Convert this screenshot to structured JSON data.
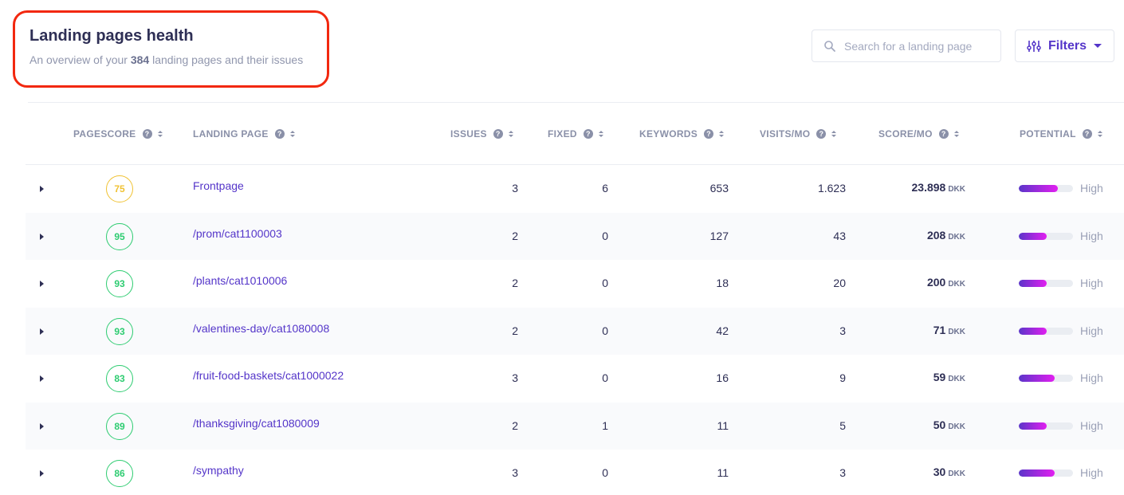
{
  "header": {
    "title": "Landing pages health",
    "subtitle_prefix": "An overview of your ",
    "subtitle_count": "384",
    "subtitle_suffix": " landing pages and their issues"
  },
  "search": {
    "placeholder": "Search for a landing page",
    "value": ""
  },
  "filters": {
    "label": "Filters"
  },
  "colors": {
    "accent": "#5435c9",
    "score_good": "#2ecc71",
    "score_medium": "#f0c233",
    "highlight_box": "#f2280f"
  },
  "columns": [
    {
      "key": "pagescore",
      "label": "PAGESCORE"
    },
    {
      "key": "landing_page",
      "label": "LANDING PAGE"
    },
    {
      "key": "issues",
      "label": "ISSUES"
    },
    {
      "key": "fixed",
      "label": "FIXED"
    },
    {
      "key": "keywords",
      "label": "KEYWORDS"
    },
    {
      "key": "visits",
      "label": "VISITS/MO"
    },
    {
      "key": "score_mo",
      "label": "SCORE/MO"
    },
    {
      "key": "potential",
      "label": "POTENTIAL"
    }
  ],
  "rows": [
    {
      "pagescore": "75",
      "score_level": "medium",
      "landing_page": "Frontpage",
      "issues": "3",
      "fixed": "6",
      "keywords": "653",
      "visits": "1.623",
      "score_mo": "23.898",
      "currency": "DKK",
      "potential": 0.72,
      "potential_label": "High"
    },
    {
      "pagescore": "95",
      "score_level": "good",
      "landing_page": "/prom/cat1100003",
      "issues": "2",
      "fixed": "0",
      "keywords": "127",
      "visits": "43",
      "score_mo": "208",
      "currency": "DKK",
      "potential": 0.52,
      "potential_label": "High"
    },
    {
      "pagescore": "93",
      "score_level": "good",
      "landing_page": "/plants/cat1010006",
      "issues": "2",
      "fixed": "0",
      "keywords": "18",
      "visits": "20",
      "score_mo": "200",
      "currency": "DKK",
      "potential": 0.52,
      "potential_label": "High"
    },
    {
      "pagescore": "93",
      "score_level": "good",
      "landing_page": "/valentines-day/cat1080008",
      "issues": "2",
      "fixed": "0",
      "keywords": "42",
      "visits": "3",
      "score_mo": "71",
      "currency": "DKK",
      "potential": 0.52,
      "potential_label": "High"
    },
    {
      "pagescore": "83",
      "score_level": "good",
      "landing_page": "/fruit-food-baskets/cat1000022",
      "issues": "3",
      "fixed": "0",
      "keywords": "16",
      "visits": "9",
      "score_mo": "59",
      "currency": "DKK",
      "potential": 0.66,
      "potential_label": "High"
    },
    {
      "pagescore": "89",
      "score_level": "good",
      "landing_page": "/thanksgiving/cat1080009",
      "issues": "2",
      "fixed": "1",
      "keywords": "11",
      "visits": "5",
      "score_mo": "50",
      "currency": "DKK",
      "potential": 0.52,
      "potential_label": "High"
    },
    {
      "pagescore": "86",
      "score_level": "good",
      "landing_page": "/sympathy",
      "issues": "3",
      "fixed": "0",
      "keywords": "11",
      "visits": "3",
      "score_mo": "30",
      "currency": "DKK",
      "potential": 0.66,
      "potential_label": "High"
    }
  ]
}
